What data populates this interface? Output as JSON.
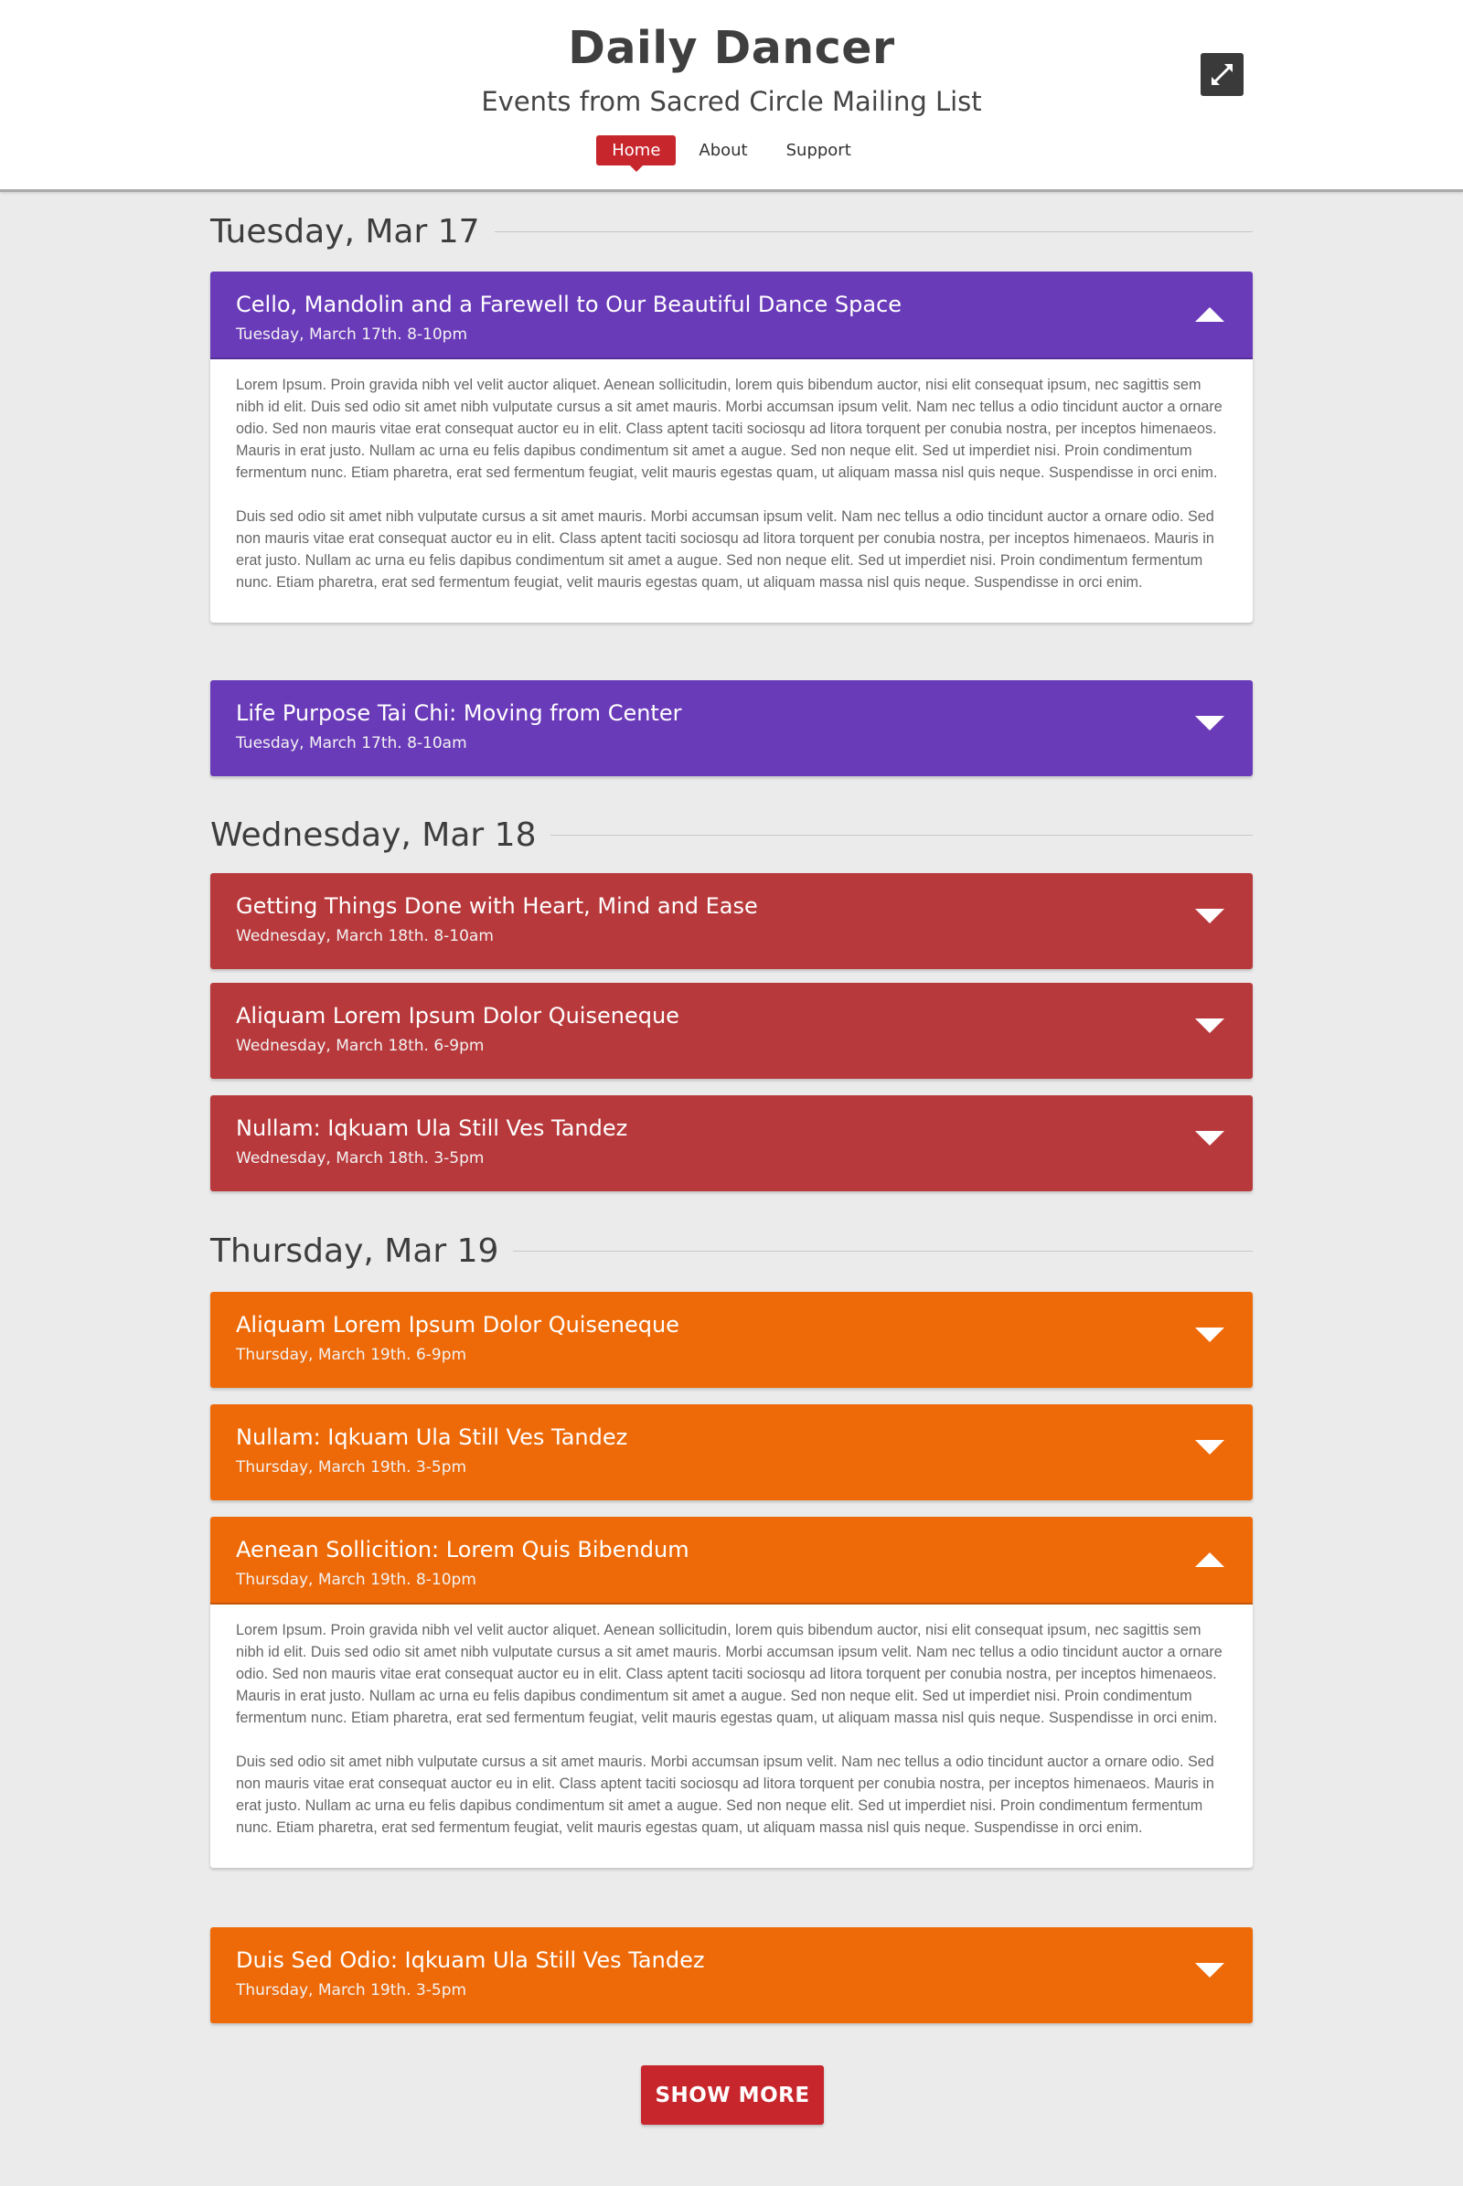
{
  "header": {
    "title": "Daily Dancer",
    "subtitle": "Events from Sacred Circle Mailing List",
    "nav": [
      {
        "label": "Home",
        "active": true
      },
      {
        "label": "About",
        "active": false
      },
      {
        "label": "Support",
        "active": false
      }
    ],
    "expand_icon": "expand-arrows-icon"
  },
  "colors": {
    "tuesday": "#6a3bb9",
    "wednesday": "#b8393c",
    "thursday": "#ee6a08",
    "accent": "#c8262d"
  },
  "body_text": {
    "p1": "Lorem Ipsum. Proin gravida nibh vel velit auctor aliquet. Aenean sollicitudin, lorem quis bibendum auctor, nisi elit consequat ipsum, nec sagittis sem nibh id elit. Duis sed odio sit amet nibh vulputate cursus a sit amet mauris. Morbi accumsan ipsum velit. Nam nec tellus a odio tincidunt auctor a ornare odio. Sed non  mauris vitae erat consequat auctor eu in elit. Class aptent taciti sociosqu ad litora torquent per conubia nostra, per inceptos himenaeos. Mauris in erat justo. Nullam ac urna eu felis dapibus condimentum sit amet a augue. Sed non neque elit. Sed ut imperdiet nisi. Proin condimentum fermentum nunc. Etiam pharetra, erat sed fermentum feugiat, velit mauris egestas quam, ut aliquam massa nisl quis neque. Suspendisse in orci enim.",
    "p2": "Duis sed odio sit amet nibh vulputate cursus a sit amet mauris. Morbi accumsan ipsum velit. Nam nec tellus a odio tincidunt auctor a ornare odio. Sed non  mauris vitae erat consequat auctor eu in elit. Class aptent taciti sociosqu ad litora torquent per conubia nostra, per inceptos himenaeos. Mauris in erat justo. Nullam ac urna eu felis dapibus condimentum sit amet a augue. Sed non neque elit. Sed ut imperdiet nisi. Proin condimentum fermentum nunc. Etiam pharetra, erat sed fermentum feugiat, velit mauris egestas quam, ut aliquam massa nisl quis neque. Suspendisse in orci enim."
  },
  "days": [
    {
      "heading": "Tuesday, Mar 17",
      "events": [
        {
          "title": "Cello, Mandolin and a Farewell to Our Beautiful Dance Space",
          "date": "Tuesday, March 17th. 8-10pm",
          "expanded": true
        },
        {
          "title": "Life Purpose Tai Chi: Moving from Center",
          "date": "Tuesday, March 17th. 8-10am",
          "expanded": false
        }
      ]
    },
    {
      "heading": "Wednesday, Mar 18",
      "events": [
        {
          "title": "Getting Things Done with Heart, Mind and Ease",
          "date": "Wednesday, March 18th. 8-10am",
          "expanded": false
        },
        {
          "title": "Aliquam Lorem Ipsum Dolor Quiseneque",
          "date": "Wednesday, March 18th. 6-9pm",
          "expanded": false
        },
        {
          "title": "Nullam: Iqkuam Ula Still Ves Tandez",
          "date": "Wednesday, March 18th. 3-5pm",
          "expanded": false
        }
      ]
    },
    {
      "heading": "Thursday, Mar 19",
      "events": [
        {
          "title": "Aliquam Lorem Ipsum Dolor Quiseneque",
          "date": "Thursday, March 19th. 6-9pm",
          "expanded": false
        },
        {
          "title": "Nullam: Iqkuam Ula Still Ves Tandez",
          "date": "Thursday, March 19th. 3-5pm",
          "expanded": false
        },
        {
          "title": "Aenean Sollicition: Lorem Quis Bibendum",
          "date": "Thursday, March 19th. 8-10pm",
          "expanded": true
        },
        {
          "title": "Duis Sed Odio: Iqkuam Ula Still Ves Tandez",
          "date": "Thursday, March 19th. 3-5pm",
          "expanded": false
        }
      ]
    }
  ],
  "show_more_label": "SHOW MORE"
}
